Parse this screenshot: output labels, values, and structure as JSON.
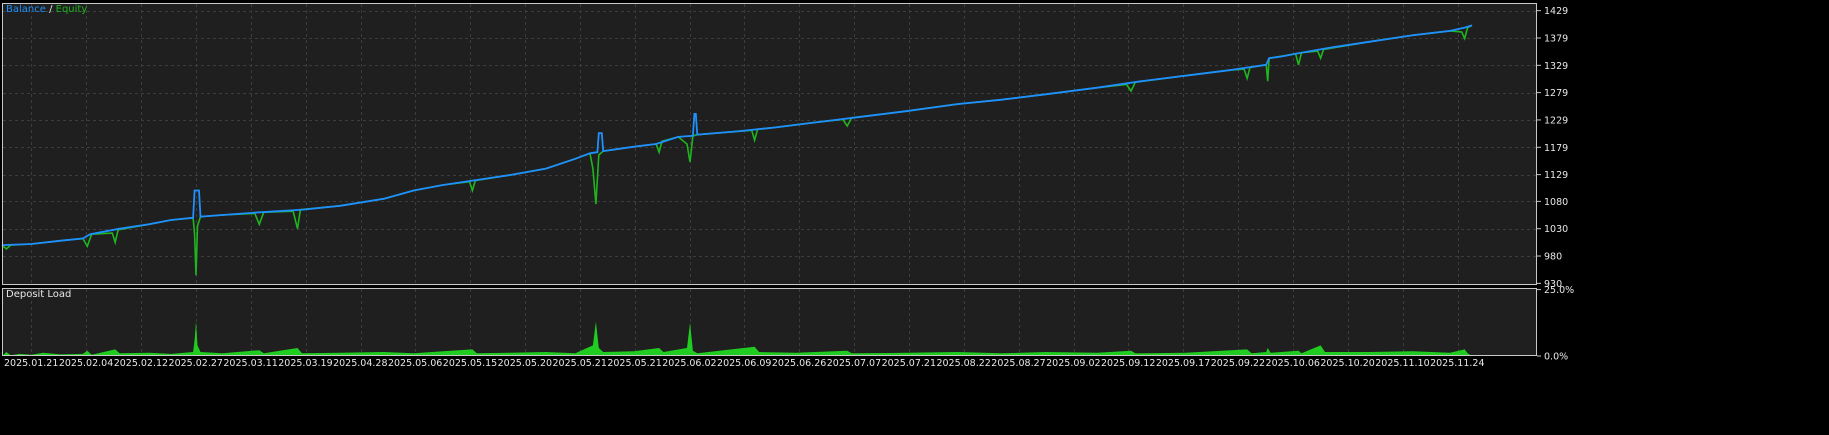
{
  "colors": {
    "background": "#000000",
    "plot_bg": "#1f1f1f",
    "grid": "#3c3c3c",
    "frame": "#c8c8c8",
    "text": "#e8e8e8",
    "balance": "#1e90ff",
    "equity": "#1fb51f",
    "deposit_load": "#1fcc1f"
  },
  "legend": {
    "balance": "Balance",
    "separator": "/",
    "equity": "Equity"
  },
  "chart_data": [
    {
      "type": "line",
      "name": "balance-equity",
      "series": [
        {
          "name": "Balance",
          "color": "#1e90ff"
        },
        {
          "name": "Equity",
          "color": "#1fb51f"
        }
      ],
      "y_ticks": [
        {
          "value": 930,
          "label": "930"
        },
        {
          "value": 980,
          "label": "980"
        },
        {
          "value": 1030,
          "label": "1030"
        },
        {
          "value": 1080,
          "label": "1080"
        },
        {
          "value": 1129,
          "label": "1129"
        },
        {
          "value": 1179,
          "label": "1179"
        },
        {
          "value": 1229,
          "label": "1229"
        },
        {
          "value": 1279,
          "label": "1279"
        },
        {
          "value": 1329,
          "label": "1329"
        },
        {
          "value": 1379,
          "label": "1379"
        },
        {
          "value": 1429,
          "label": "1429"
        }
      ],
      "ylim": [
        927,
        1443
      ],
      "xlim": [
        0,
        1000
      ],
      "balance_points": [
        [
          0,
          1000
        ],
        [
          20,
          1002
        ],
        [
          40,
          1008
        ],
        [
          55,
          1012
        ],
        [
          60,
          1020
        ],
        [
          80,
          1030
        ],
        [
          100,
          1038
        ],
        [
          115,
          1046
        ],
        [
          130,
          1050
        ],
        [
          131,
          1100
        ],
        [
          134,
          1100
        ],
        [
          135,
          1052
        ],
        [
          150,
          1055
        ],
        [
          175,
          1060
        ],
        [
          205,
          1065
        ],
        [
          230,
          1072
        ],
        [
          260,
          1085
        ],
        [
          280,
          1100
        ],
        [
          300,
          1110
        ],
        [
          320,
          1118
        ],
        [
          345,
          1128
        ],
        [
          370,
          1140
        ],
        [
          390,
          1158
        ],
        [
          400,
          1168
        ],
        [
          405,
          1170
        ],
        [
          406,
          1205
        ],
        [
          408,
          1205
        ],
        [
          409,
          1172
        ],
        [
          430,
          1180
        ],
        [
          445,
          1185
        ],
        [
          460,
          1198
        ],
        [
          470,
          1200
        ],
        [
          471,
          1240
        ],
        [
          472,
          1240
        ],
        [
          473,
          1202
        ],
        [
          500,
          1208
        ],
        [
          525,
          1215
        ],
        [
          555,
          1225
        ],
        [
          585,
          1235
        ],
        [
          615,
          1245
        ],
        [
          650,
          1258
        ],
        [
          680,
          1266
        ],
        [
          710,
          1276
        ],
        [
          745,
          1288
        ],
        [
          775,
          1300
        ],
        [
          805,
          1310
        ],
        [
          835,
          1320
        ],
        [
          860,
          1330
        ],
        [
          862,
          1342
        ],
        [
          870,
          1345
        ],
        [
          880,
          1350
        ],
        [
          905,
          1362
        ],
        [
          930,
          1372
        ],
        [
          960,
          1384
        ],
        [
          985,
          1392
        ],
        [
          995,
          1398
        ],
        [
          1000,
          1402
        ]
      ],
      "equity_points": [
        [
          0,
          1000
        ],
        [
          3,
          993
        ],
        [
          6,
          1000
        ],
        [
          20,
          1002
        ],
        [
          40,
          1008
        ],
        [
          55,
          1012
        ],
        [
          58,
          998
        ],
        [
          61,
          1020
        ],
        [
          75,
          1022
        ],
        [
          77,
          1005
        ],
        [
          79,
          1028
        ],
        [
          100,
          1038
        ],
        [
          115,
          1046
        ],
        [
          130,
          1050
        ],
        [
          131,
          1020
        ],
        [
          132,
          945
        ],
        [
          133,
          1035
        ],
        [
          135,
          1052
        ],
        [
          150,
          1055
        ],
        [
          172,
          1058
        ],
        [
          175,
          1038
        ],
        [
          178,
          1060
        ],
        [
          198,
          1062
        ],
        [
          201,
          1030
        ],
        [
          203,
          1065
        ],
        [
          230,
          1072
        ],
        [
          260,
          1085
        ],
        [
          280,
          1100
        ],
        [
          300,
          1110
        ],
        [
          318,
          1116
        ],
        [
          320,
          1100
        ],
        [
          322,
          1118
        ],
        [
          345,
          1128
        ],
        [
          370,
          1140
        ],
        [
          390,
          1158
        ],
        [
          400,
          1168
        ],
        [
          402,
          1140
        ],
        [
          404,
          1075
        ],
        [
          406,
          1165
        ],
        [
          409,
          1172
        ],
        [
          430,
          1180
        ],
        [
          445,
          1185
        ],
        [
          447,
          1170
        ],
        [
          449,
          1190
        ],
        [
          460,
          1198
        ],
        [
          466,
          1185
        ],
        [
          468,
          1152
        ],
        [
          470,
          1200
        ],
        [
          473,
          1202
        ],
        [
          500,
          1208
        ],
        [
          510,
          1210
        ],
        [
          512,
          1192
        ],
        [
          514,
          1212
        ],
        [
          525,
          1215
        ],
        [
          555,
          1225
        ],
        [
          572,
          1230
        ],
        [
          575,
          1218
        ],
        [
          578,
          1233
        ],
        [
          615,
          1245
        ],
        [
          650,
          1258
        ],
        [
          680,
          1266
        ],
        [
          710,
          1276
        ],
        [
          745,
          1288
        ],
        [
          765,
          1294
        ],
        [
          768,
          1282
        ],
        [
          771,
          1298
        ],
        [
          805,
          1310
        ],
        [
          835,
          1320
        ],
        [
          845,
          1322
        ],
        [
          847,
          1305
        ],
        [
          849,
          1325
        ],
        [
          860,
          1330
        ],
        [
          861,
          1300
        ],
        [
          862,
          1342
        ],
        [
          880,
          1350
        ],
        [
          882,
          1330
        ],
        [
          884,
          1352
        ],
        [
          895,
          1355
        ],
        [
          897,
          1342
        ],
        [
          899,
          1358
        ],
        [
          930,
          1372
        ],
        [
          960,
          1384
        ],
        [
          985,
          1392
        ],
        [
          993,
          1390
        ],
        [
          995,
          1378
        ],
        [
          997,
          1398
        ],
        [
          1000,
          1402
        ]
      ]
    },
    {
      "type": "area",
      "name": "deposit-load",
      "title": "Deposit Load",
      "y_ticks": [
        {
          "value": 25,
          "label": "25.0%"
        },
        {
          "value": 0,
          "label": "0.0%"
        }
      ],
      "ylim": [
        0,
        25.6
      ],
      "xlim": [
        0,
        1000
      ],
      "load_points": [
        [
          0,
          0
        ],
        [
          3,
          1.5
        ],
        [
          6,
          0.3
        ],
        [
          12,
          0.8
        ],
        [
          20,
          0.5
        ],
        [
          28,
          1.2
        ],
        [
          40,
          0.6
        ],
        [
          55,
          0.8
        ],
        [
          58,
          2
        ],
        [
          61,
          0.5
        ],
        [
          77,
          2.5
        ],
        [
          80,
          1
        ],
        [
          100,
          1.2
        ],
        [
          115,
          0.8
        ],
        [
          130,
          1.5
        ],
        [
          131,
          6
        ],
        [
          132,
          13
        ],
        [
          133,
          4
        ],
        [
          135,
          1.5
        ],
        [
          150,
          1
        ],
        [
          175,
          2.2
        ],
        [
          178,
          1
        ],
        [
          201,
          3
        ],
        [
          204,
          1
        ],
        [
          230,
          1.2
        ],
        [
          260,
          1.5
        ],
        [
          280,
          1
        ],
        [
          300,
          1.8
        ],
        [
          320,
          2.5
        ],
        [
          323,
          1
        ],
        [
          345,
          1.2
        ],
        [
          370,
          1.5
        ],
        [
          390,
          1
        ],
        [
          402,
          4
        ],
        [
          404,
          13
        ],
        [
          406,
          3
        ],
        [
          409,
          1.5
        ],
        [
          430,
          1.8
        ],
        [
          447,
          3
        ],
        [
          450,
          1.5
        ],
        [
          466,
          3
        ],
        [
          468,
          12.5
        ],
        [
          470,
          2
        ],
        [
          473,
          1
        ],
        [
          512,
          3.5
        ],
        [
          515,
          1.5
        ],
        [
          540,
          1.2
        ],
        [
          575,
          2
        ],
        [
          578,
          1
        ],
        [
          615,
          1.2
        ],
        [
          650,
          1.5
        ],
        [
          680,
          1
        ],
        [
          710,
          1.5
        ],
        [
          745,
          1.2
        ],
        [
          768,
          2
        ],
        [
          771,
          1
        ],
        [
          805,
          1.2
        ],
        [
          847,
          2.5
        ],
        [
          850,
          1
        ],
        [
          860,
          1.5
        ],
        [
          861,
          3
        ],
        [
          863,
          1.2
        ],
        [
          882,
          2
        ],
        [
          884,
          1
        ],
        [
          897,
          4
        ],
        [
          900,
          1.5
        ],
        [
          930,
          1.5
        ],
        [
          960,
          1.8
        ],
        [
          985,
          1.2
        ],
        [
          995,
          2.5
        ],
        [
          997,
          1
        ],
        [
          1000,
          0
        ]
      ]
    }
  ],
  "x_axis": {
    "labels": [
      "2025.01.21",
      "2025.02.04",
      "2025.02.12",
      "2025.02.27",
      "2025.03.11",
      "2025.03.19",
      "2025.04.28",
      "2025.05.06",
      "2025.05.15",
      "2025.05.20",
      "2025.05.21",
      "2025.05.21",
      "2025.06.02",
      "2025.06.09",
      "2025.06.26",
      "2025.07.07",
      "2025.07.21",
      "2025.08.22",
      "2025.08.27",
      "2025.09.02",
      "2025.09.12",
      "2025.09.17",
      "2025.09.22",
      "2025.10.06",
      "2025.10.20",
      "2025.11.10",
      "2025.11.24"
    ]
  }
}
